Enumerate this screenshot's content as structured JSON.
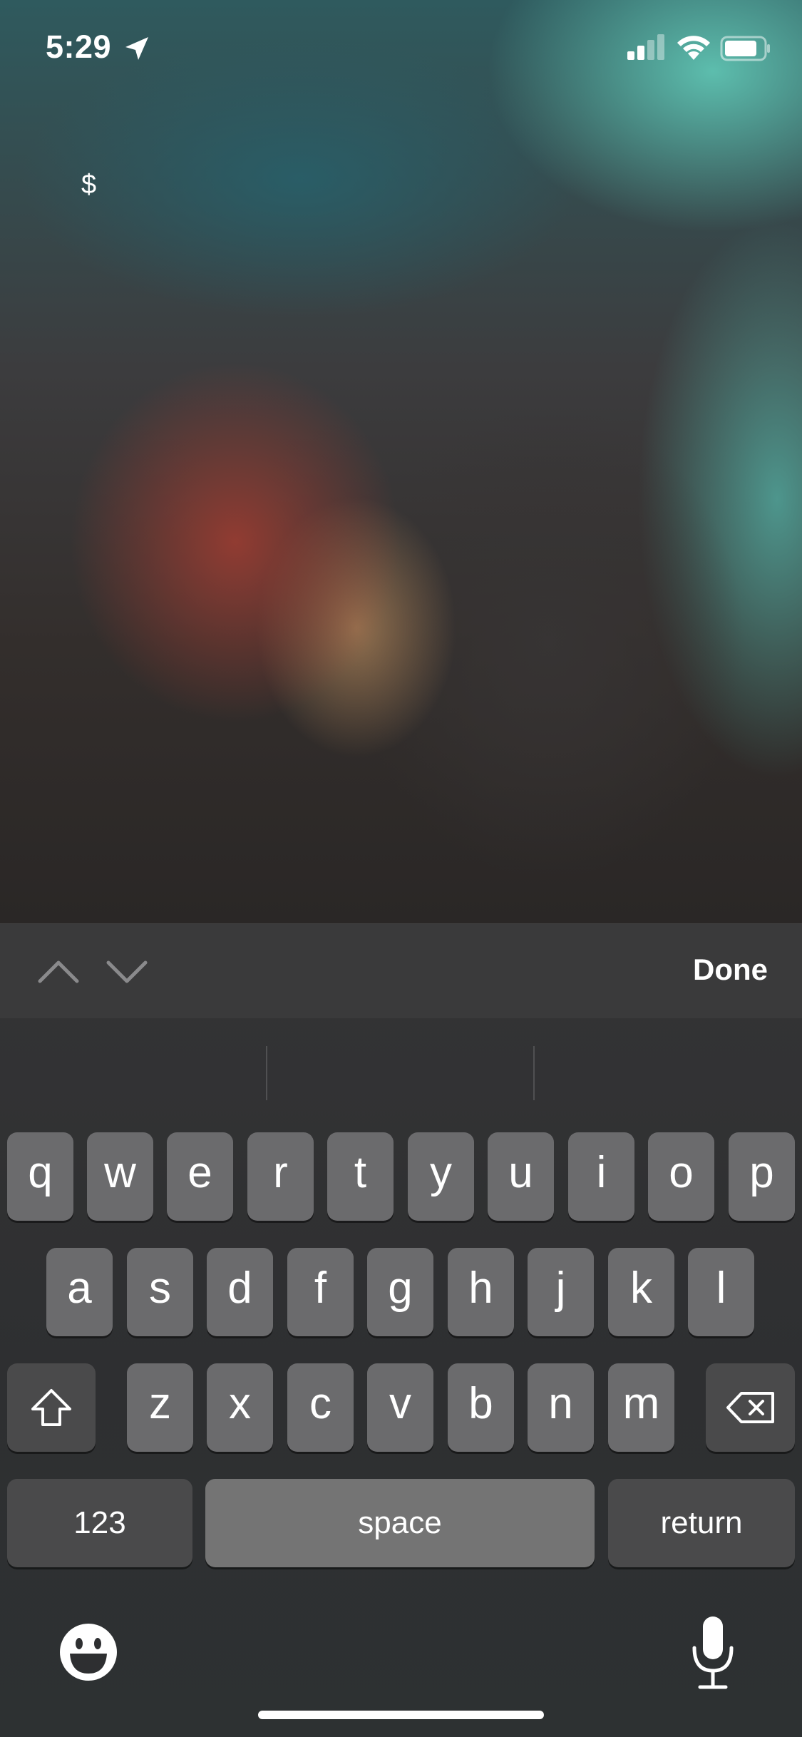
{
  "status_bar": {
    "time": "5:29",
    "icons": [
      "location-arrow-icon",
      "cellular-signal-icon",
      "wifi-icon",
      "battery-icon"
    ]
  },
  "content": {
    "currency_symbol": "$"
  },
  "accessory_bar": {
    "done_label": "Done",
    "icons": [
      "chevron-up-icon",
      "chevron-down-icon"
    ]
  },
  "keyboard": {
    "row1": [
      "q",
      "w",
      "e",
      "r",
      "t",
      "y",
      "u",
      "i",
      "o",
      "p"
    ],
    "row2": [
      "a",
      "s",
      "d",
      "f",
      "g",
      "h",
      "j",
      "k",
      "l"
    ],
    "row3": [
      "z",
      "x",
      "c",
      "v",
      "b",
      "n",
      "m"
    ],
    "numbers_label": "123",
    "space_label": "space",
    "return_label": "return",
    "icons": [
      "shift-icon",
      "delete-icon",
      "emoji-icon",
      "microphone-icon"
    ]
  },
  "colors": {
    "key": "#6b6b6d",
    "function_key": "#4a4a4b",
    "accessory_bar": "#3a3a3b",
    "text": "#ffffff"
  }
}
